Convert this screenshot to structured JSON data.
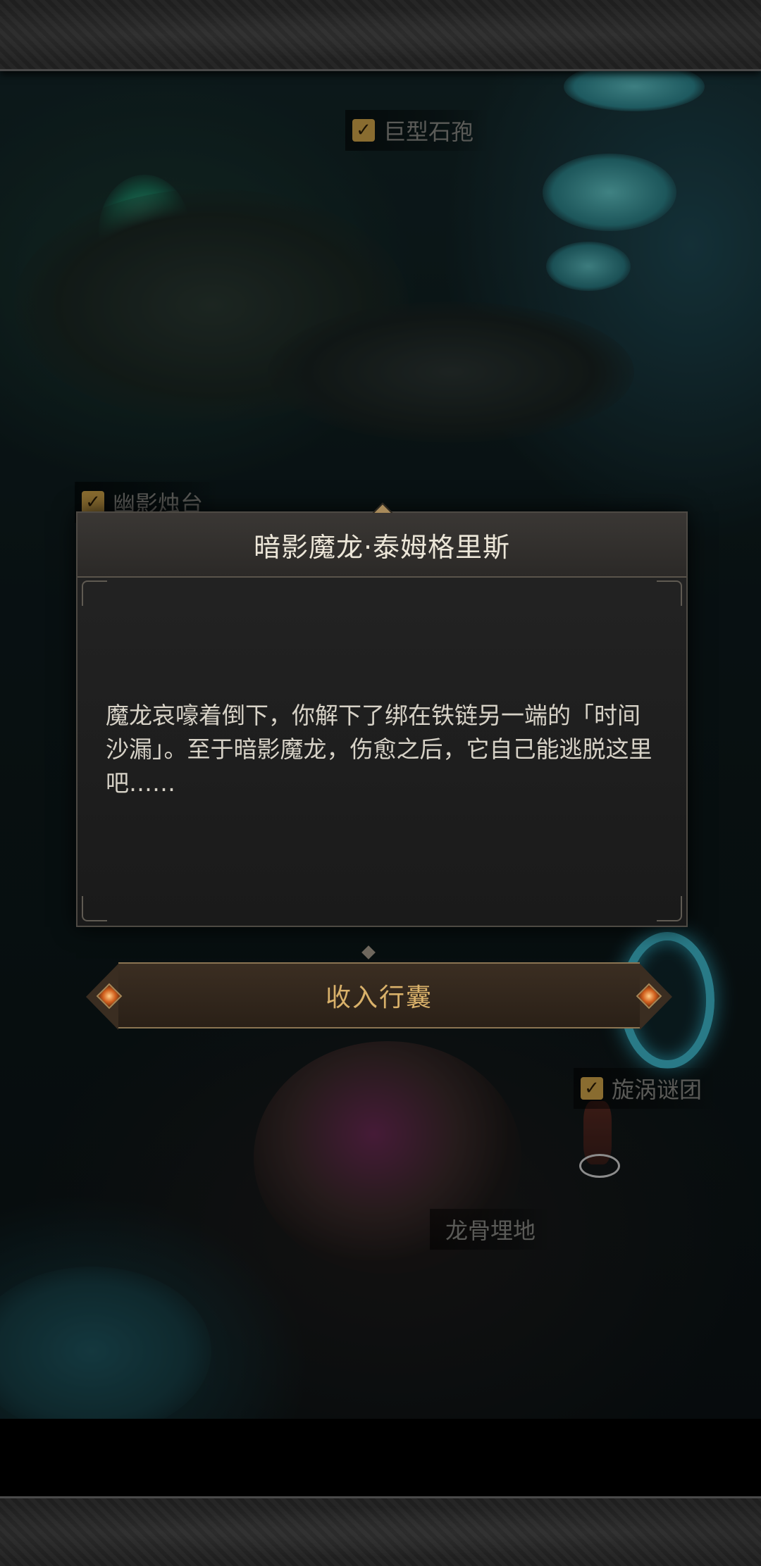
{
  "map": {
    "locations": [
      {
        "name": "巨型石孢",
        "checked": true
      },
      {
        "name": "幽影烛台",
        "checked": true
      },
      {
        "name": "旋涡谜团",
        "checked": true
      },
      {
        "name": "龙骨埋地",
        "checked": false
      }
    ]
  },
  "dialog": {
    "title": "暗影魔龙·泰姆格里斯",
    "body": "魔龙哀嚎着倒下，你解下了绑在铁链另一端的「时间沙漏」。至于暗影魔龙，伤愈之后，它自己能逃脱这里吧……"
  },
  "action_button": {
    "label": "收入行囊"
  },
  "colors": {
    "accent_gold": "#d9b16a",
    "check_gold": "#d3a64a",
    "dialog_bg": "#1f1f1f",
    "portal_teal": "#3fbcd0"
  }
}
